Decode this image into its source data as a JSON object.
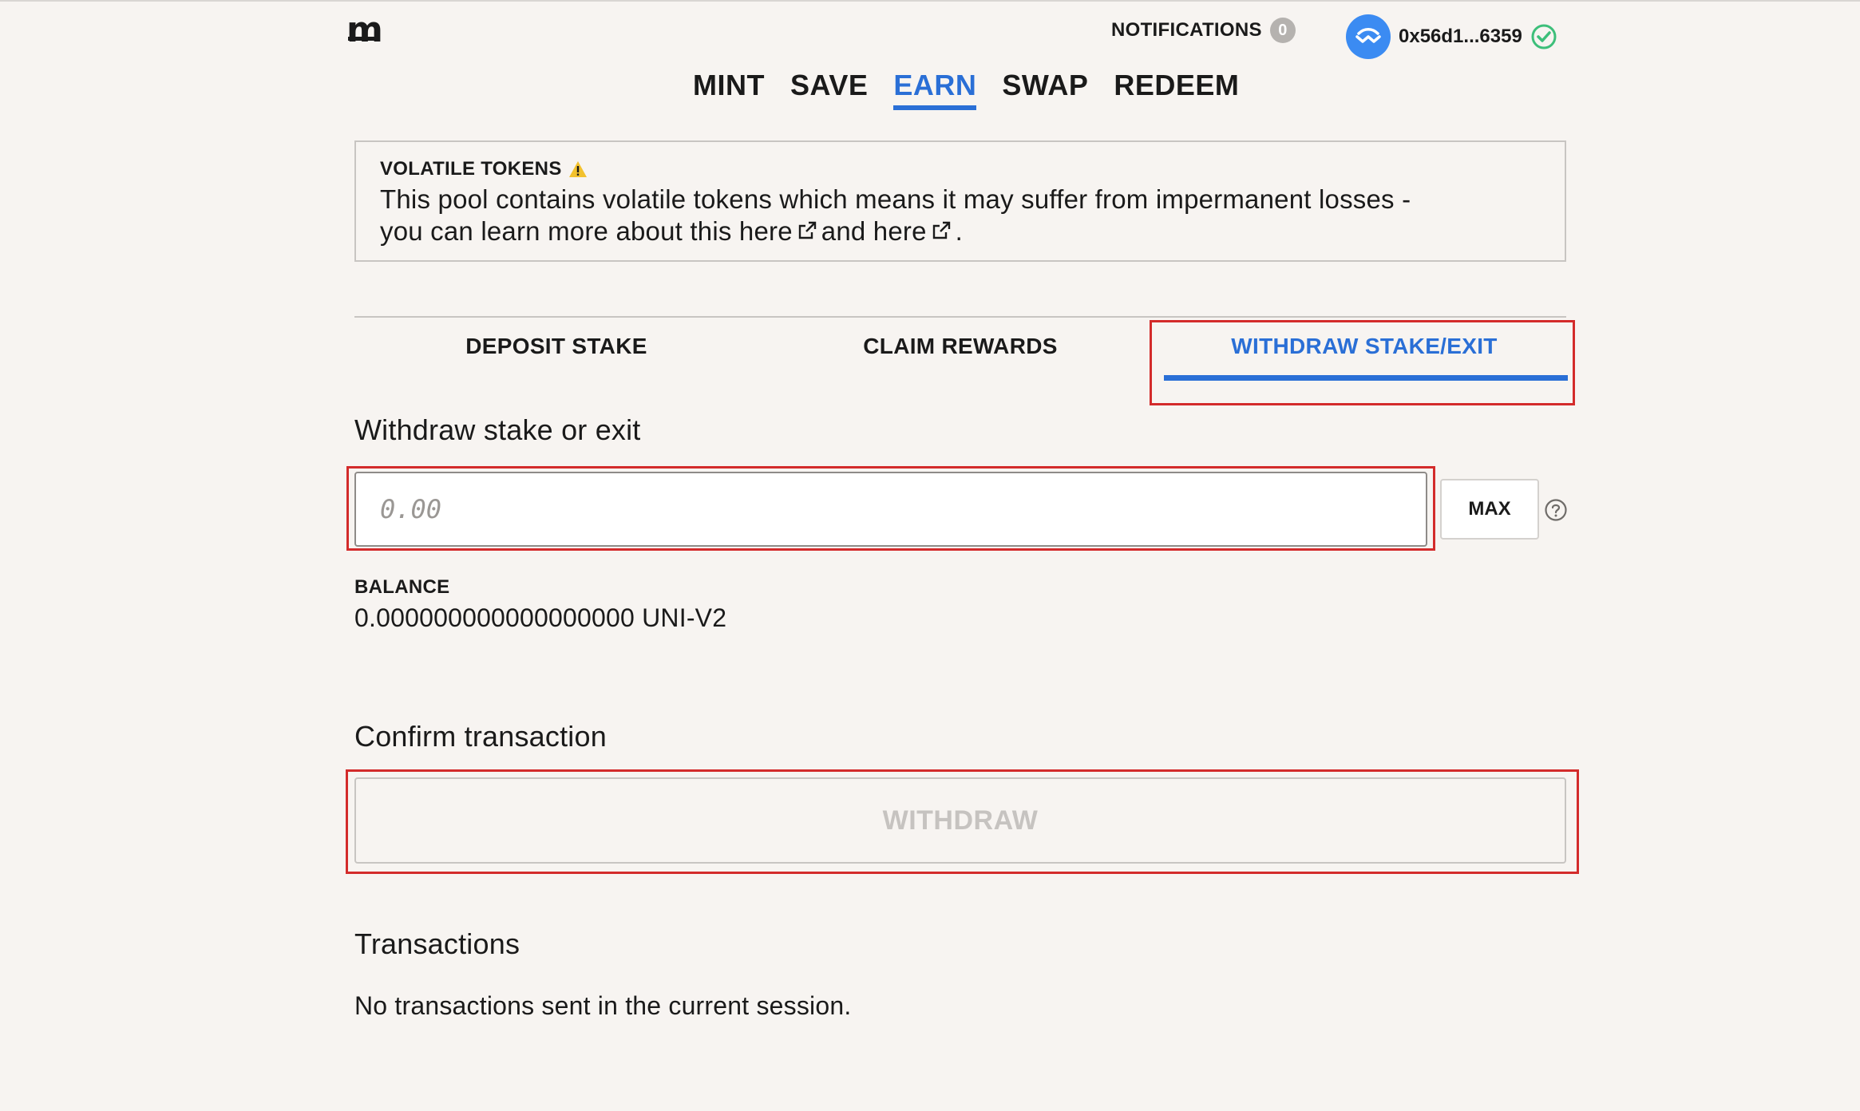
{
  "header": {
    "logo": "m",
    "notifications_label": "NOTIFICATIONS",
    "notifications_count": "0",
    "wallet_address": "0x56d1...6359"
  },
  "main_nav": {
    "items": [
      {
        "label": "MINT",
        "active": false
      },
      {
        "label": "SAVE",
        "active": false
      },
      {
        "label": "EARN",
        "active": true
      },
      {
        "label": "SWAP",
        "active": false
      },
      {
        "label": "REDEEM",
        "active": false
      }
    ]
  },
  "alert": {
    "title": "VOLATILE TOKENS",
    "text_part1": "This pool contains volatile tokens which means it may suffer from impermanent losses -",
    "text_part2": "you can learn more about this here",
    "link1": "",
    "text_part3": "and here",
    "text_end": "."
  },
  "tabs": {
    "deposit": "DEPOSIT STAKE",
    "claim": "CLAIM REWARDS",
    "withdraw": "WITHDRAW STAKE/EXIT",
    "active": "withdraw"
  },
  "withdraw": {
    "label": "Withdraw stake or exit",
    "amount_placeholder": "0.00",
    "amount_value": "",
    "max_label": "MAX"
  },
  "balance": {
    "title": "BALANCE",
    "value": "0.000000000000000000 UNI-V2"
  },
  "confirm": {
    "label": "Confirm transaction",
    "button_label": "WITHDRAW",
    "button_disabled": true
  },
  "transactions": {
    "label": "Transactions",
    "empty_text": "No transactions sent in the current session."
  },
  "colors": {
    "background": "#f7f4f1",
    "accent_blue": "#2a6fd6",
    "highlight_red": "#d32b2b",
    "success_green": "#3dbf7a"
  }
}
